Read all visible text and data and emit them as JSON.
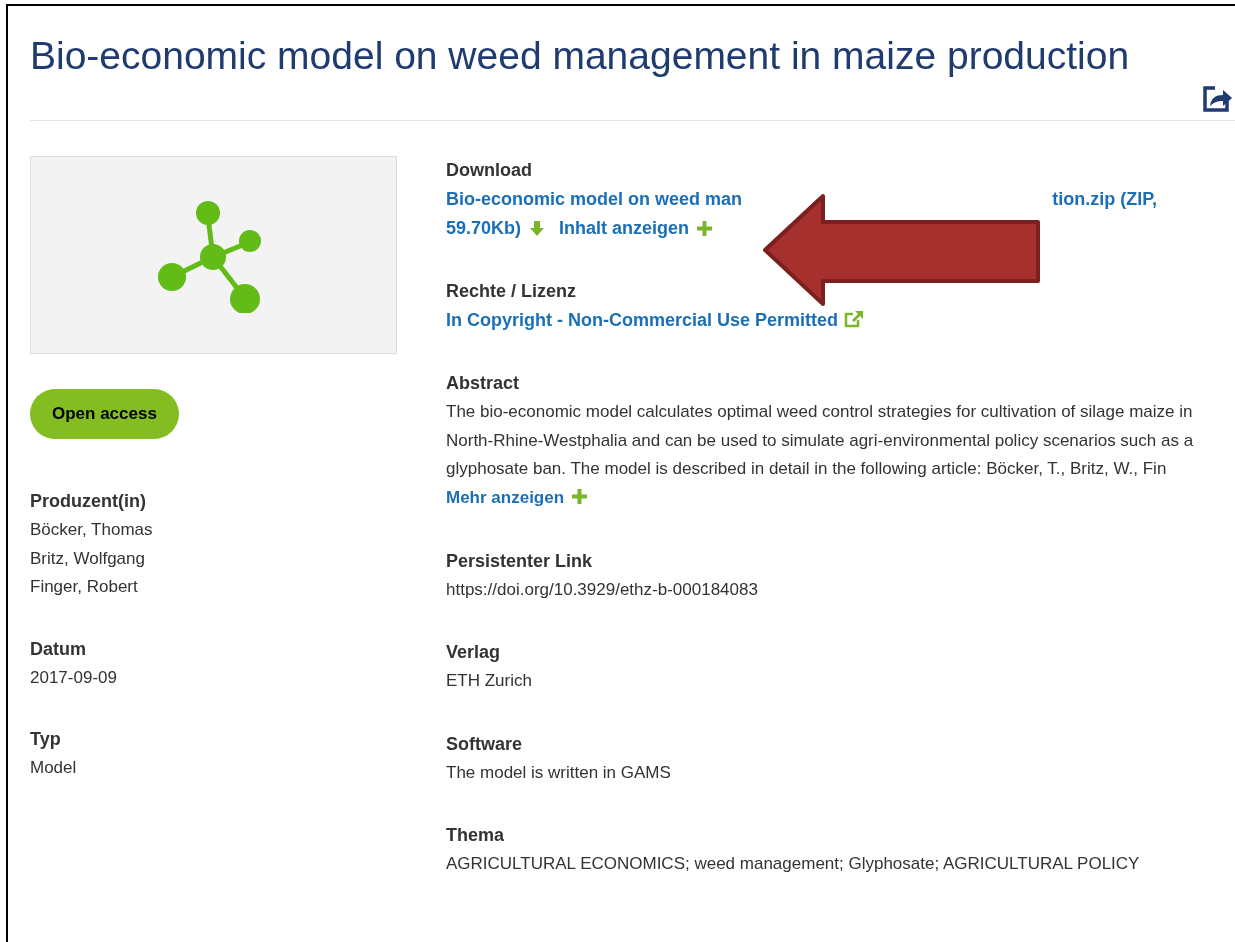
{
  "title": "Bio-economic model on weed management in maize production",
  "left": {
    "badge": "Open access",
    "fields": [
      {
        "heading": "Produzent(in)",
        "values": [
          "Böcker, Thomas",
          "Britz, Wolfgang",
          "Finger, Robert"
        ]
      },
      {
        "heading": "Datum",
        "values": [
          "2017-09-09"
        ]
      },
      {
        "heading": "Typ",
        "values": [
          "Model"
        ]
      }
    ]
  },
  "download": {
    "heading": "Download",
    "link_start": "Bio-economic model on weed man",
    "link_end": "tion.zip (ZIP,",
    "link_line_2": "59.70Kb)",
    "toggle": "Inhalt anzeigen"
  },
  "license": {
    "heading": "Rechte / Lizenz",
    "link": "In Copyright - Non-Commercial Use Permitted"
  },
  "abstract": {
    "heading": "Abstract",
    "text": "The bio-economic model calculates optimal weed control strategies for cultivation of silage maize in North-Rhine-Westphalia and can be used to simulate agri-environmental policy scenarios such as a glyphosate ban. The model is described in detail in the following article: Böcker, T., Britz, W., Fin",
    "more": "Mehr anzeigen"
  },
  "fields": [
    {
      "heading": "Persistenter Link",
      "values": [
        "https://doi.org/10.3929/ethz-b-000184083"
      ]
    },
    {
      "heading": "Verlag",
      "values": [
        "ETH Zurich"
      ]
    },
    {
      "heading": "Software",
      "values": [
        "The model is written in GAMS"
      ]
    },
    {
      "heading": "Thema",
      "values": [
        "AGRICULTURAL ECONOMICS; weed management; Glyphosate; AGRICULTURAL POLICY"
      ]
    }
  ]
}
